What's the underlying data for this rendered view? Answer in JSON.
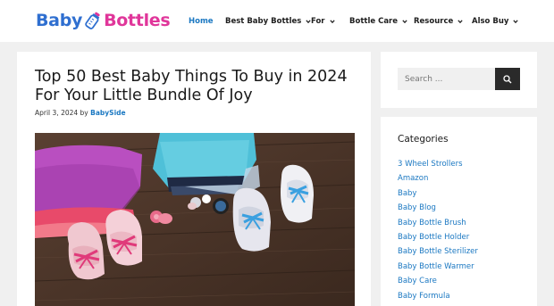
{
  "header": {
    "logo": {
      "word1": "Baby",
      "word2": "Bottles"
    },
    "nav": [
      {
        "label": "Home",
        "active": true,
        "dropdown": false
      },
      {
        "label": "Best Baby Bottles",
        "active": false,
        "dropdown": true
      },
      {
        "label": "For",
        "active": false,
        "dropdown": true
      },
      {
        "label": "Bottle Care",
        "active": false,
        "dropdown": true
      },
      {
        "label": "Resource",
        "active": false,
        "dropdown": true
      },
      {
        "label": "Also Buy",
        "active": false,
        "dropdown": true
      }
    ]
  },
  "article": {
    "title": "Top 50 Best Baby Things To Buy in 2024 For Your Little Bundle Of Joy",
    "date": "April 3, 2024",
    "by": "by",
    "author": "BabySide"
  },
  "sidebar": {
    "search": {
      "placeholder": "Search ..."
    },
    "categories": {
      "title": "Categories",
      "items": [
        "3 Wheel Strollers",
        "Amazon",
        "Baby",
        "Baby Blog",
        "Baby Bottle Brush",
        "Baby Bottle Holder",
        "Baby Bottle Sterilizer",
        "Baby Bottle Warmer",
        "Baby Care",
        "Baby Formula"
      ]
    }
  },
  "colors": {
    "link": "#1b78c2",
    "logo_blue": "#2f6fd0",
    "logo_pink": "#e0369a",
    "search_button": "#2a2a2a"
  }
}
